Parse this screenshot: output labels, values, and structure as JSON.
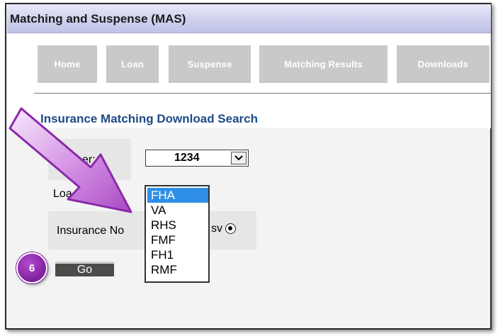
{
  "app": {
    "title": "Matching and Suspense (MAS)"
  },
  "nav": {
    "tabs": [
      {
        "label": "Home"
      },
      {
        "label": "Loan"
      },
      {
        "label": "Suspense"
      },
      {
        "label": "Matching Results"
      },
      {
        "label": "Downloads"
      }
    ]
  },
  "page": {
    "title": "Insurance Matching Download Search"
  },
  "form": {
    "servicer_label": "er:",
    "servicer_value": "1234",
    "loan_label": "Loa",
    "insurance_label": "Insurance No",
    "insurance_suffix": "sv",
    "loan_type_options": [
      "FHA",
      "VA",
      "RHS",
      "FMF",
      "FH1",
      "RMF"
    ],
    "loan_type_selected": "FHA",
    "go_label": "Go"
  },
  "annotation": {
    "step_number": "6"
  },
  "colors": {
    "accent": "#1e4b86",
    "highlight": "#2f8fe6",
    "callout": "#8a2aa8"
  }
}
